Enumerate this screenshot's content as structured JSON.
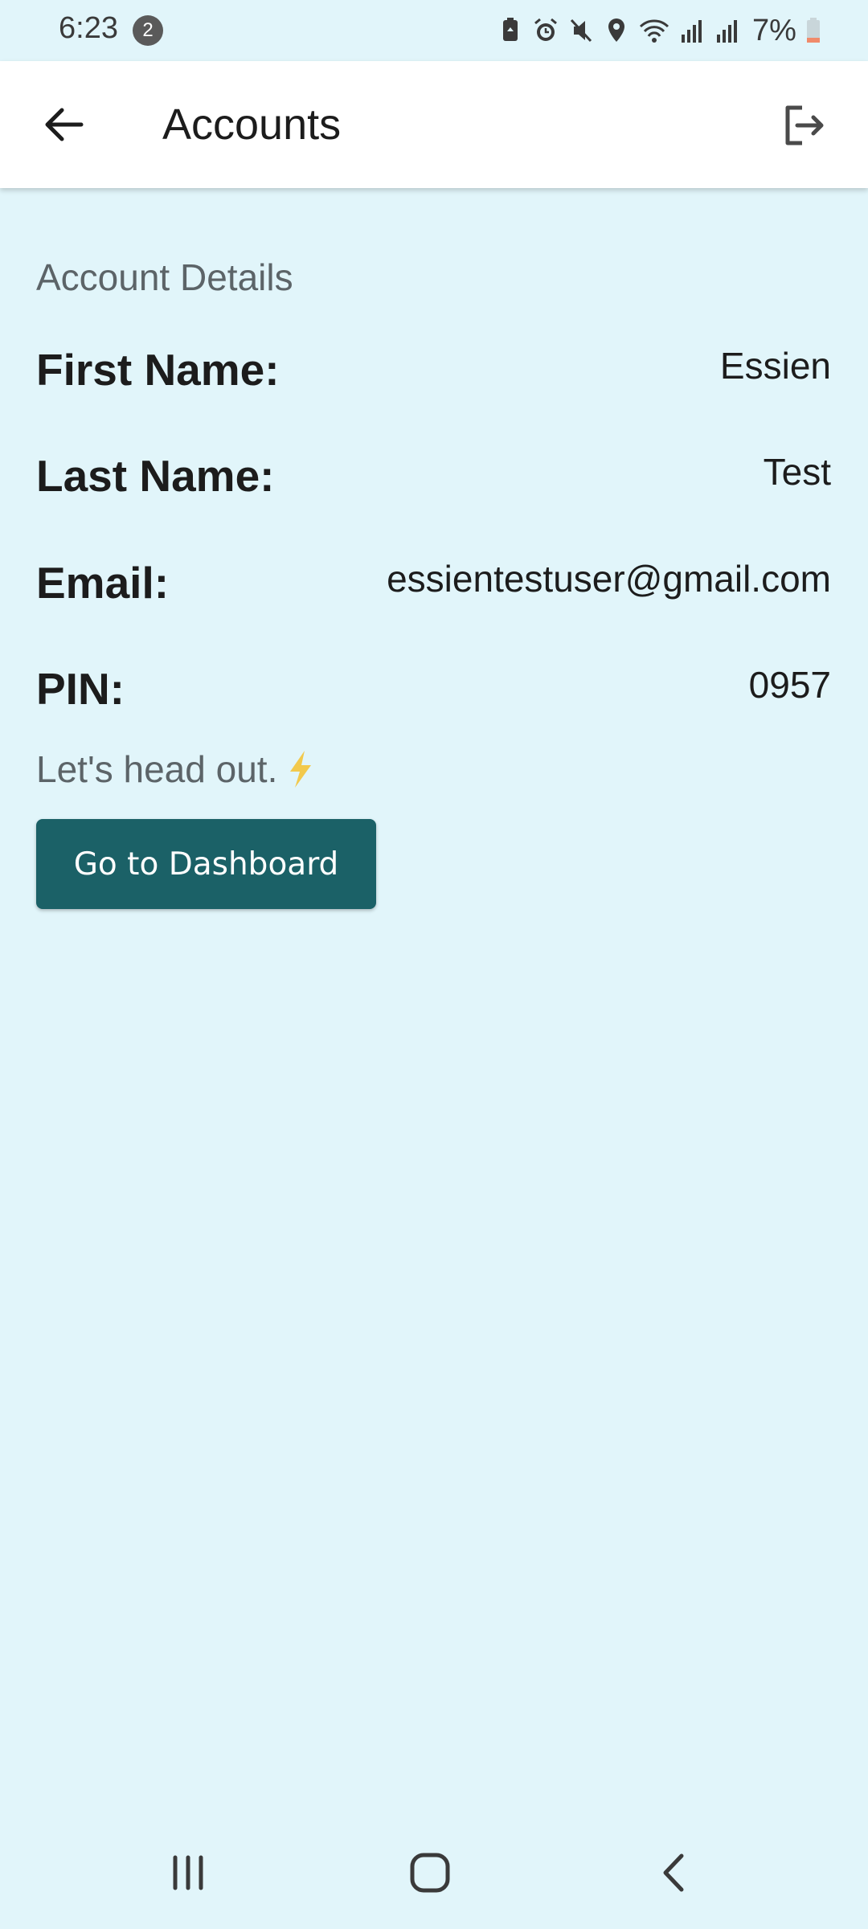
{
  "status_bar": {
    "time": "6:23",
    "notification_count": "2",
    "battery": "7%",
    "icons": [
      "battery-saver-icon",
      "alarm-icon",
      "mute-icon",
      "location-icon",
      "wifi-icon",
      "signal-icon",
      "signal-icon",
      "battery-icon"
    ]
  },
  "app_bar": {
    "title": "Accounts",
    "back_icon": "arrow-left-icon",
    "logout_icon": "logout-icon"
  },
  "account": {
    "heading": "Account Details",
    "fields": [
      {
        "label": "First Name:",
        "value": "Essien"
      },
      {
        "label": "Last Name:",
        "value": "Test"
      },
      {
        "label": "Email:",
        "value": "essientestuser@gmail.com"
      },
      {
        "label": "PIN:",
        "value": "0957"
      }
    ],
    "tagline": "Let's head out.",
    "tagline_icon": "lightning-icon",
    "dashboard_button": "Go to Dashboard"
  },
  "nav_bar": {
    "recents_icon": "recents-icon",
    "home_icon": "home-icon",
    "back_icon": "back-chevron-icon"
  },
  "colors": {
    "background": "#e1f5fa",
    "app_bar": "#ffffff",
    "button": "#1b6167",
    "lightning": "#f2c94c"
  }
}
